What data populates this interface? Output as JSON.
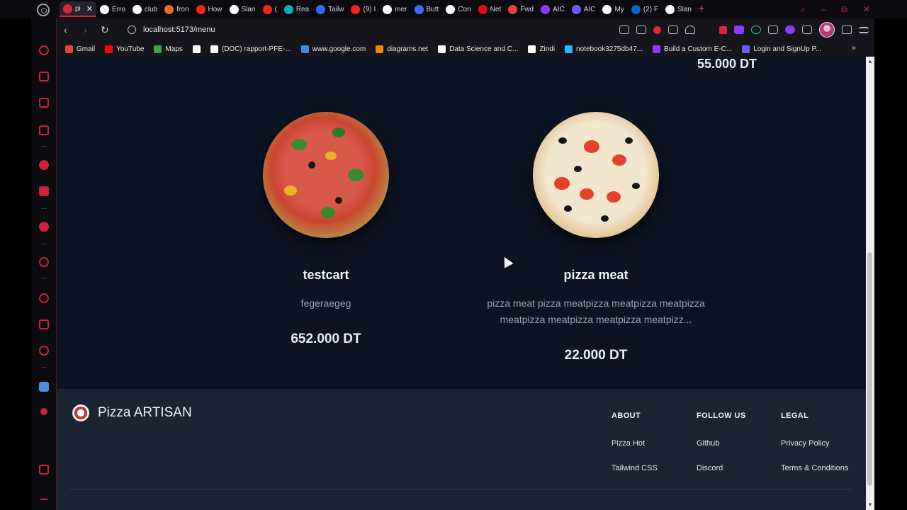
{
  "browser": {
    "tabs": [
      {
        "label": "pi",
        "color": "#e0243b",
        "active": true
      },
      {
        "label": "Erro",
        "color": "#ffffff"
      },
      {
        "label": "club",
        "color": "#ffffff"
      },
      {
        "label": "fron",
        "color": "#f46a25"
      },
      {
        "label": "How",
        "color": "#ff2020"
      },
      {
        "label": "Slan",
        "color": "#ffffff"
      },
      {
        "label": "(",
        "color": "#ff2020"
      },
      {
        "label": "Rea",
        "color": "#17a6c8"
      },
      {
        "label": "Tailw",
        "color": "#2b6cff"
      },
      {
        "label": "(9) I",
        "color": "#ff2020"
      },
      {
        "label": "mer",
        "color": "#ffffff"
      },
      {
        "label": "Butt",
        "color": "#3b6cff"
      },
      {
        "label": "Con",
        "color": "#ffffff"
      },
      {
        "label": "Net",
        "color": "#e50914"
      },
      {
        "label": "Fwd",
        "color": "#ea4335"
      },
      {
        "label": "AIC",
        "color": "#8a3bff"
      },
      {
        "label": "AIC",
        "color": "#6a5cff"
      },
      {
        "label": "My",
        "color": "#ffffff"
      },
      {
        "label": "(2) F",
        "color": "#0a66c2"
      },
      {
        "label": "Slan",
        "color": "#ffffff"
      }
    ],
    "close_glyph": "✕",
    "new_tab_glyph": "+",
    "window_controls": {
      "search": "⌕",
      "minimize": "–",
      "restore": "⧉",
      "close": "✕"
    },
    "back_glyph": "‹",
    "forward_glyph": "›",
    "reload_glyph": "↻",
    "url": "localhost:5173/menu",
    "bookmarks": [
      {
        "label": "Gmail",
        "color": "#ea4335"
      },
      {
        "label": "YouTube",
        "color": "#ff0000"
      },
      {
        "label": "Maps",
        "color": "#34a853"
      },
      {
        "label": "",
        "color": "#ffffff"
      },
      {
        "label": "(DOC) rapport-PFE-...",
        "color": "#ffffff"
      },
      {
        "label": "www.google.com",
        "color": "#4285f4"
      },
      {
        "label": "diagrams.net",
        "color": "#f08705"
      },
      {
        "label": "Data Science and C...",
        "color": "#ffffff"
      },
      {
        "label": "Zindi",
        "color": "#ffffff"
      },
      {
        "label": "notebook3275db47...",
        "color": "#20beff"
      },
      {
        "label": "Build a Custom E-C...",
        "color": "#8a3bff"
      },
      {
        "label": "Login and SignUp P...",
        "color": "#6a5cff"
      }
    ],
    "bookmarks_more": "»"
  },
  "page": {
    "prev_price": "55.000 DT",
    "products": [
      {
        "name": "testcart",
        "description": "fegeraegeg",
        "price": "652.000 DT"
      },
      {
        "name": "pizza meat",
        "description": "pizza meat pizza meatpizza meatpizza meatpizza meatpizza meatpizza meatpizza meatpizz...",
        "price": "22.000 DT"
      }
    ]
  },
  "footer": {
    "brand": "Pizza ARTISAN",
    "columns": [
      {
        "title": "ABOUT",
        "links": [
          "Pizza Hot",
          "Tailwind CSS"
        ]
      },
      {
        "title": "FOLLOW US",
        "links": [
          "Github",
          "Discord"
        ]
      },
      {
        "title": "LEGAL",
        "links": [
          "Privacy Policy",
          "Terms & Conditions"
        ]
      }
    ]
  },
  "colors": {
    "accent": "#e0243b",
    "page_bg": "#0c1322",
    "footer_bg": "#1b2432"
  }
}
